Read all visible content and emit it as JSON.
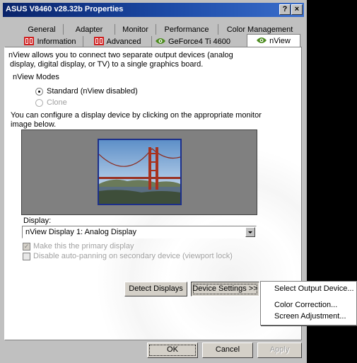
{
  "window": {
    "title": "ASUS V8460 v28.32b Properties",
    "help_button": "?",
    "close_button": "×"
  },
  "tabs": {
    "row1": [
      "General",
      "Adapter",
      "Monitor",
      "Performance",
      "Color Management"
    ],
    "row2": [
      "Information",
      "Advanced",
      "GeForce4 Ti 4600",
      "nView"
    ],
    "active": "nView"
  },
  "nview": {
    "intro_line1": "nView allows you to connect two separate output devices (analog",
    "intro_line2": "display, digital display, or TV) to a single graphics board.",
    "modes_label": "nView Modes",
    "mode_standard": "Standard (nView disabled)",
    "mode_clone": "Clone",
    "selected_mode": "Standard (nView disabled)",
    "configure_line1": "You can configure a display device by clicking on the appropriate monitor",
    "configure_line2": "image below.",
    "display_label": "Display:",
    "display_value": "nView Display 1: Analog Display",
    "primary_check": "Make this the primary display",
    "primary_checked": true,
    "autopan_check": "Disable auto-panning on secondary device (viewport lock)",
    "autopan_checked": false,
    "detect_button": "Detect Displays",
    "device_settings_button": "Device Settings >>"
  },
  "context_menu": {
    "items": [
      "Select Output Device...",
      "Color Correction...",
      "Screen Adjustment..."
    ]
  },
  "footer": {
    "ok": "OK",
    "cancel": "Cancel",
    "apply": "Apply"
  },
  "colors": {
    "title_bar": "#0a246a",
    "dialog_face": "#c0c0c0",
    "monitor_area": "#808080",
    "monitor_border": "#1c2f8a",
    "tab_icon_red": "#d02020"
  },
  "icons": [
    "nvidia-logo-icon",
    "monitor-image",
    "golden-gate-bridge-image",
    "dropdown-arrow-icon"
  ]
}
